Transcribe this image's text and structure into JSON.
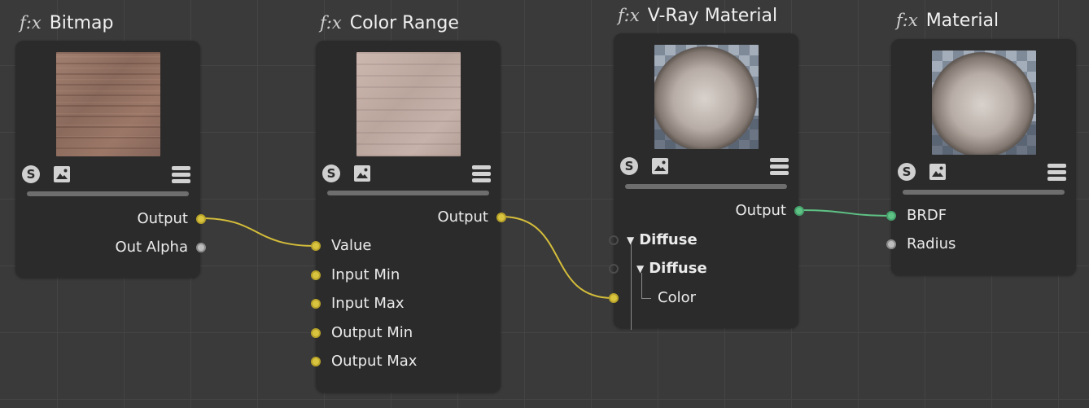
{
  "nodes": {
    "bitmap": {
      "title": "Bitmap",
      "fx": "f:x",
      "outputs": [
        "Output",
        "Out Alpha"
      ]
    },
    "color_range": {
      "title": "Color Range",
      "fx": "f:x",
      "outputs": [
        "Output"
      ],
      "inputs": [
        "Value",
        "Input Min",
        "Input Max",
        "Output Min",
        "Output Max"
      ]
    },
    "vray_material": {
      "title": "V-Ray Material",
      "fx": "f:x",
      "outputs": [
        "Output"
      ],
      "groups": [
        "Diffuse",
        "Diffuse"
      ],
      "inputs": [
        "Color"
      ]
    },
    "material": {
      "title": "Material",
      "fx": "f:x",
      "inputs": [
        "BRDF",
        "Radius"
      ]
    }
  },
  "icons": {
    "shader": "s-icon",
    "preview": "image-icon",
    "menu": "menu-icon"
  },
  "icon_glyphs": {
    "shader_letter": "S"
  },
  "colors": {
    "background": "#3a3a3a",
    "node_bg": "#2b2b2b",
    "port_color": "#d9c440",
    "port_bsdf": "#5fc285",
    "port_neutral": "#bdbdbd",
    "wire_color": "#d4bd3a",
    "wire_bsdf": "#5fc285"
  }
}
